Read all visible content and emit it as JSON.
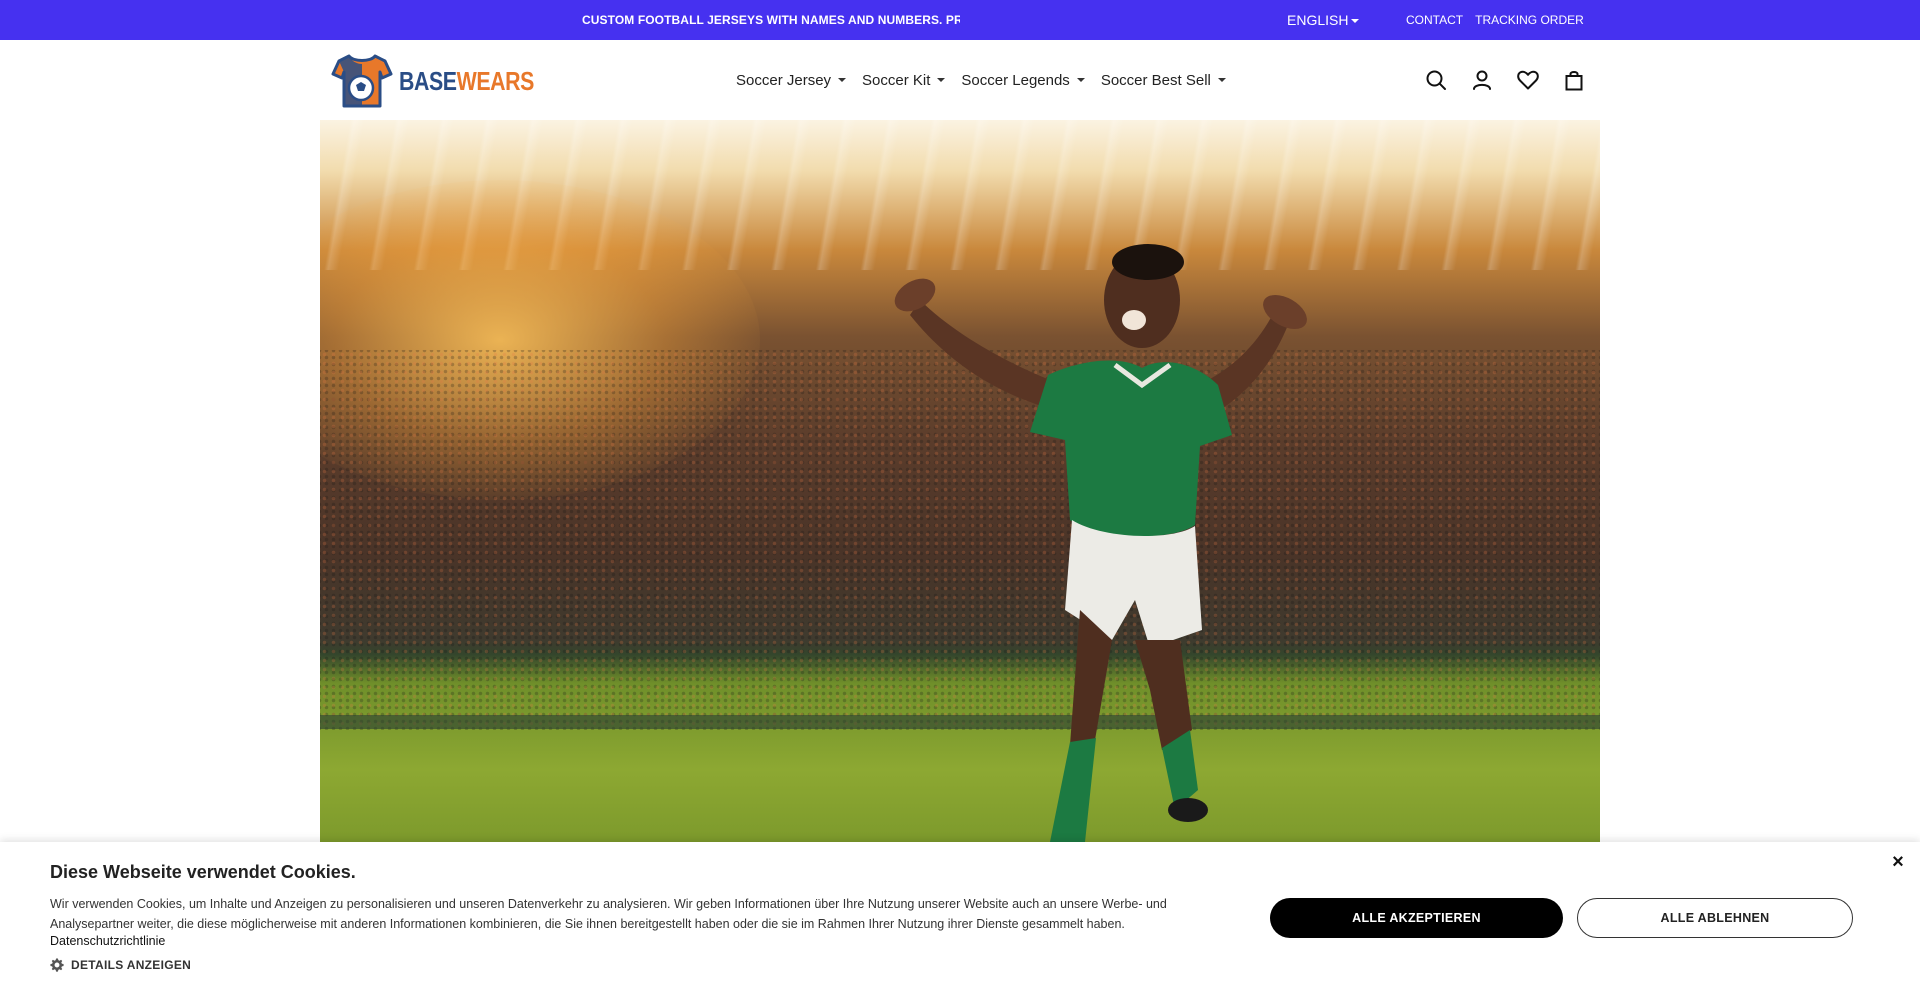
{
  "topbar": {
    "announcement": "CUSTOM FOOTBALL JERSEYS WITH NAMES AND NUMBERS. PRE",
    "language": "ENGLISH",
    "links": [
      "CONTACT",
      "TRACKING ORDER"
    ]
  },
  "header": {
    "logo": {
      "part1": "BASE",
      "part2": "WEARS"
    },
    "nav": [
      {
        "label": "Soccer Jersey"
      },
      {
        "label": "Soccer Kit"
      },
      {
        "label": "Soccer Legends"
      },
      {
        "label": "Soccer Best Sell"
      }
    ],
    "icons": [
      "search-icon",
      "account-icon",
      "wishlist-icon",
      "cart-icon"
    ]
  },
  "cookie": {
    "title": "Diese Webseite verwendet Cookies.",
    "text_line1": "Wir verwenden Cookies, um Inhalte und Anzeigen zu personalisieren und unseren Datenverkehr zu analysieren. Wir geben Informationen über Ihre Nutzung unserer Website auch an unsere Werbe- und",
    "text_line2": "Analysepartner weiter, die diese möglicherweise mit anderen Informationen kombinieren, die Sie ihnen bereitgestellt haben oder die sie im Rahmen Ihrer Nutzung ihrer Dienste gesammelt haben.",
    "policy_link": "Datenschutzrichtlinie",
    "details_label": "DETAILS ANZEIGEN",
    "accept_label": "ALLE AKZEPTIEREN",
    "reject_label": "ALLE ABLEHNEN",
    "close_symbol": "×"
  },
  "colors": {
    "topbar": "#4631f0",
    "logo_primary": "#2a4d86",
    "logo_accent": "#e8782a"
  }
}
